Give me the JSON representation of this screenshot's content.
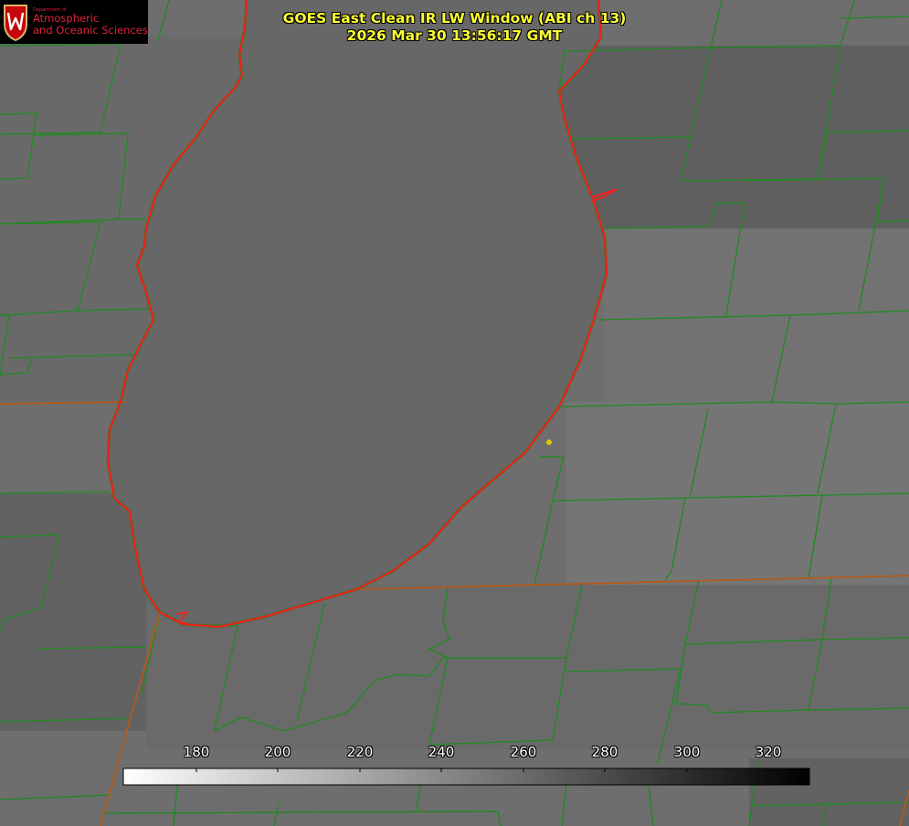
{
  "logo": {
    "department": "Department of",
    "line1": "Atmospheric",
    "line2": "and Oceanic Sciences",
    "icon": "uw-crest-icon"
  },
  "title": {
    "line1": "GOES East Clean IR LW Window (ABI ch 13)",
    "line2": "2026 Mar 30 13:56:17 GMT"
  },
  "colorbar": {
    "ticks": [
      "180",
      "200",
      "220",
      "240",
      "260",
      "280",
      "300",
      "320"
    ],
    "gradient": [
      "#ffffff",
      "#000000"
    ]
  },
  "colors": {
    "background": "#6f6f6f",
    "lake": "#676767",
    "county_lines": "#1f8a1f",
    "shoreline": "#ff1a1a",
    "state_line": "#b35a1a",
    "marker": "#e0c800",
    "title_text": "#ffff33"
  }
}
